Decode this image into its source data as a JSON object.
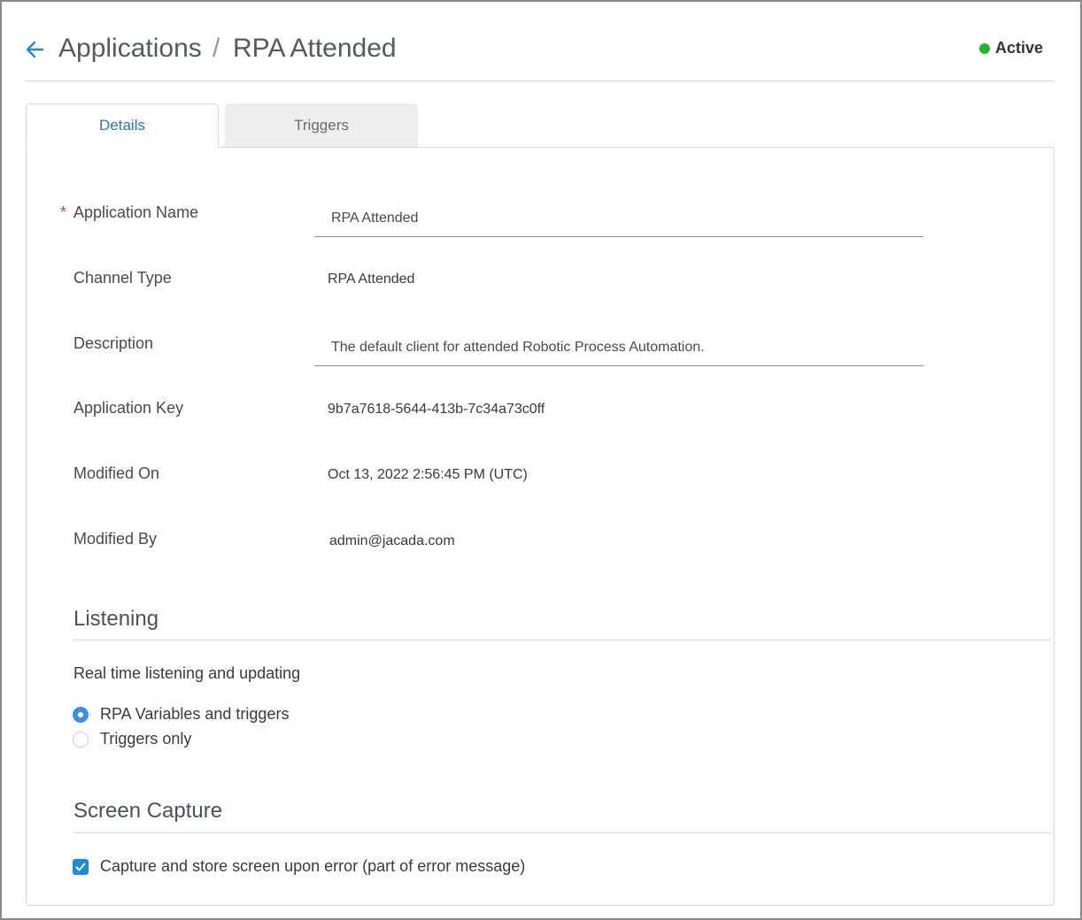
{
  "header": {
    "breadcrumb_root": "Applications",
    "breadcrumb_sep": "/",
    "breadcrumb_current": "RPA Attended",
    "status_label": "Active",
    "status_color": "#22b32f"
  },
  "tabs": [
    {
      "label": "Details",
      "active": true
    },
    {
      "label": "Triggers",
      "active": false
    }
  ],
  "details": {
    "required_marker": "*",
    "application_name_label": "Application Name",
    "application_name_value": "RPA Attended",
    "channel_type_label": "Channel Type",
    "channel_type_value": "RPA Attended",
    "description_label": "Description",
    "description_value": "The default client for attended Robotic Process Automation.",
    "application_key_label": "Application Key",
    "application_key_value": "9b7a7618-5644-413b-7c34a73c0ff",
    "modified_on_label": "Modified On",
    "modified_on_value": "Oct 13, 2022 2:56:45 PM (UTC)",
    "modified_by_label": "Modified By",
    "modified_by_value": "admin@jacada.com"
  },
  "listening": {
    "title": "Listening",
    "description": "Real time listening and updating",
    "options": [
      {
        "label": "RPA Variables and triggers",
        "selected": true
      },
      {
        "label": "Triggers only",
        "selected": false
      }
    ]
  },
  "screen_capture": {
    "title": "Screen Capture",
    "checkbox_label": "Capture and store screen upon error (part of error message)",
    "checked": true
  },
  "colors": {
    "accent": "#2b77b5",
    "radio_selected": "#3d8fe0",
    "checkbox": "#1f8ad6",
    "required": "#e0453a"
  }
}
